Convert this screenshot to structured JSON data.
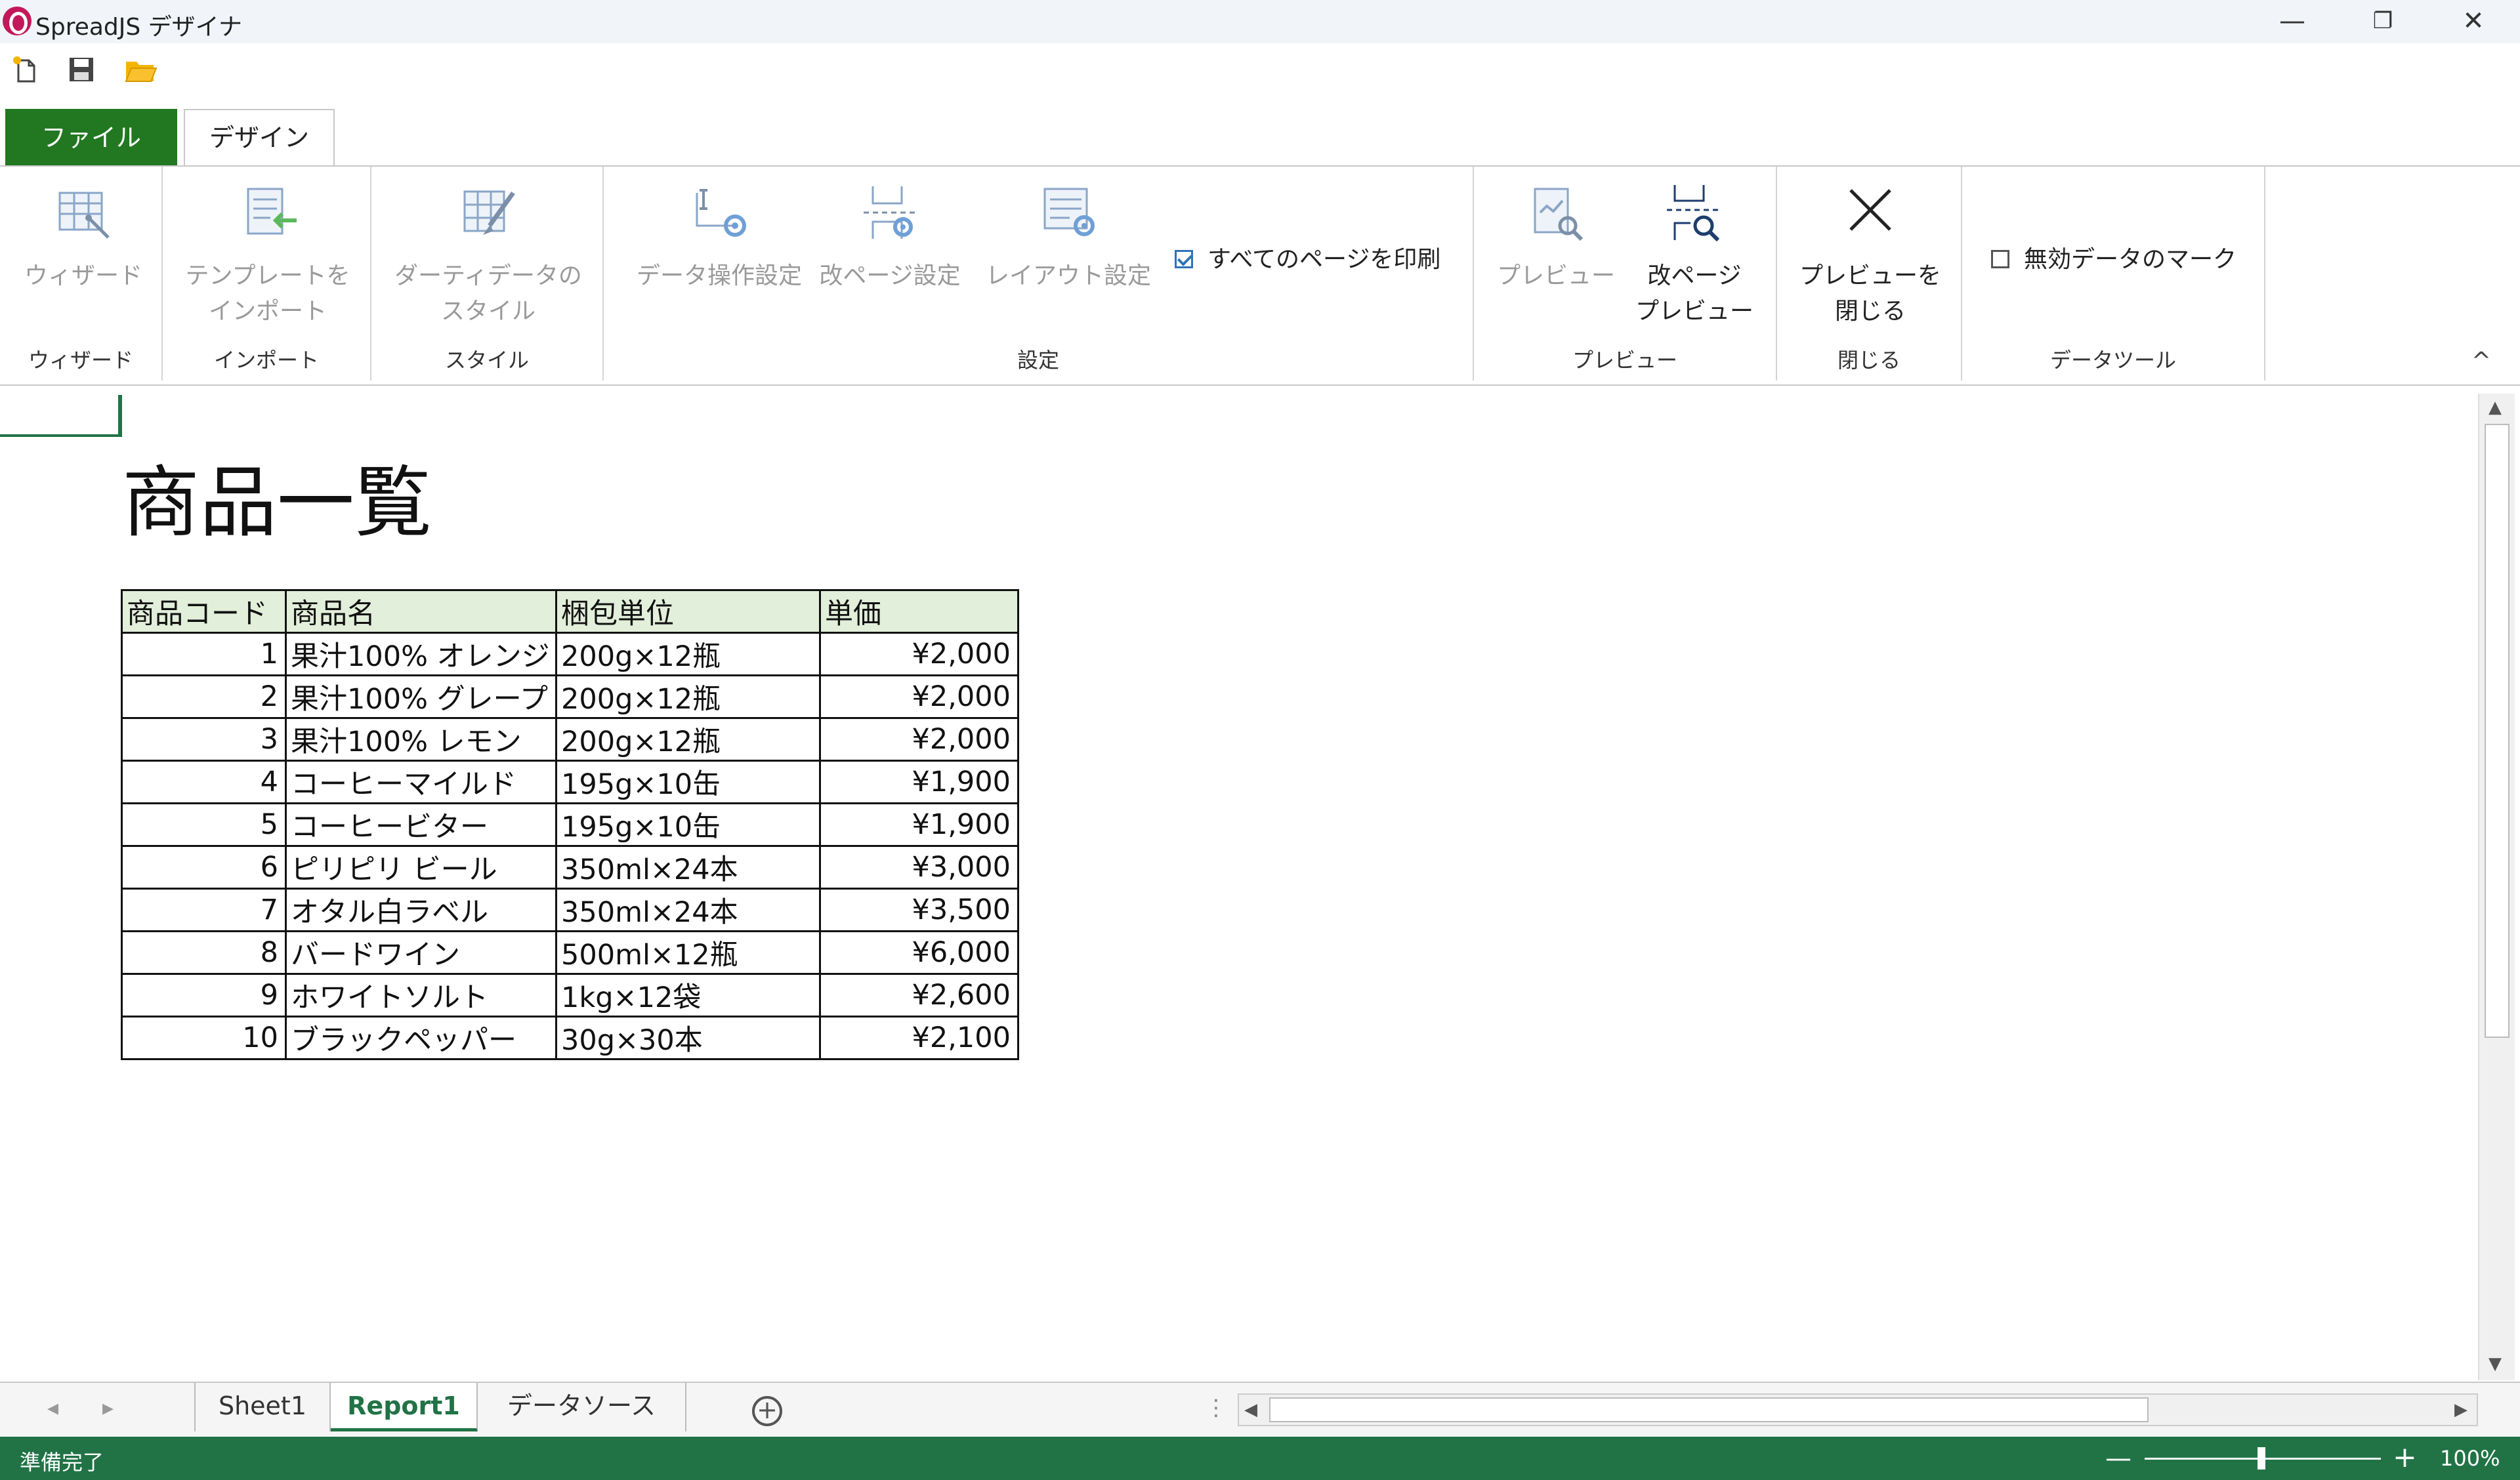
{
  "window": {
    "title": "SpreadJS デザイナ",
    "min_label": "—",
    "restore_label": "❐",
    "close_label": "✕"
  },
  "ribbon_tabs": {
    "file": "ファイル",
    "design": "デザイン"
  },
  "ribbon": {
    "groups": {
      "wizard": "ウィザード",
      "import": "インポート",
      "style": "スタイル",
      "settings": "設定",
      "preview": "プレビュー",
      "close": "閉じる",
      "datatools": "データツール"
    },
    "buttons": {
      "wizard": "ウィザード",
      "import_l1": "テンプレートを",
      "import_l2": "インポート",
      "dirty_l1": "ダーティデータの",
      "dirty_l2": "スタイル",
      "data_op": "データ操作設定",
      "pagebreak": "改ページ設定",
      "layout": "レイアウト設定",
      "preview": "プレビュー",
      "pb_preview_l1": "改ページ",
      "pb_preview_l2": "プレビュー",
      "close_l1": "プレビューを",
      "close_l2": "閉じる"
    },
    "checkboxes": {
      "print_all": "すべてのページを印刷",
      "print_all_checked": true,
      "invalid_mark": "無効データのマーク",
      "invalid_mark_checked": false
    },
    "collapse_label": "^"
  },
  "report": {
    "title": "商品一覧",
    "headers": [
      "商品コード",
      "商品名",
      "梱包単位",
      "単価"
    ],
    "rows": [
      [
        "1",
        "果汁100% オレンジ",
        "200g×12瓶",
        "¥2,000"
      ],
      [
        "2",
        "果汁100% グレープ",
        "200g×12瓶",
        "¥2,000"
      ],
      [
        "3",
        "果汁100% レモン",
        "200g×12瓶",
        "¥2,000"
      ],
      [
        "4",
        "コーヒーマイルド",
        "195g×10缶",
        "¥1,900"
      ],
      [
        "5",
        "コーヒービター",
        "195g×10缶",
        "¥1,900"
      ],
      [
        "6",
        "ピリピリ ビール",
        "350ml×24本",
        "¥3,000"
      ],
      [
        "7",
        "オタル白ラベル",
        "350ml×24本",
        "¥3,500"
      ],
      [
        "8",
        "バードワイン",
        "500ml×12瓶",
        "¥6,000"
      ],
      [
        "9",
        "ホワイトソルト",
        "1kg×12袋",
        "¥2,600"
      ],
      [
        "10",
        "ブラックペッパー",
        "30g×30本",
        "¥2,100"
      ]
    ]
  },
  "sheet_tabs": {
    "sheet1": "Sheet1",
    "report1": "Report1",
    "datasource": "データソース",
    "active": "Report1"
  },
  "status": {
    "text": "準備完了",
    "zoom": "100%",
    "zoom_percent": 100
  },
  "colors": {
    "accent": "#217346",
    "file_tab": "#217821",
    "header_fill": "#e2efda",
    "logo": "#c2185b"
  }
}
